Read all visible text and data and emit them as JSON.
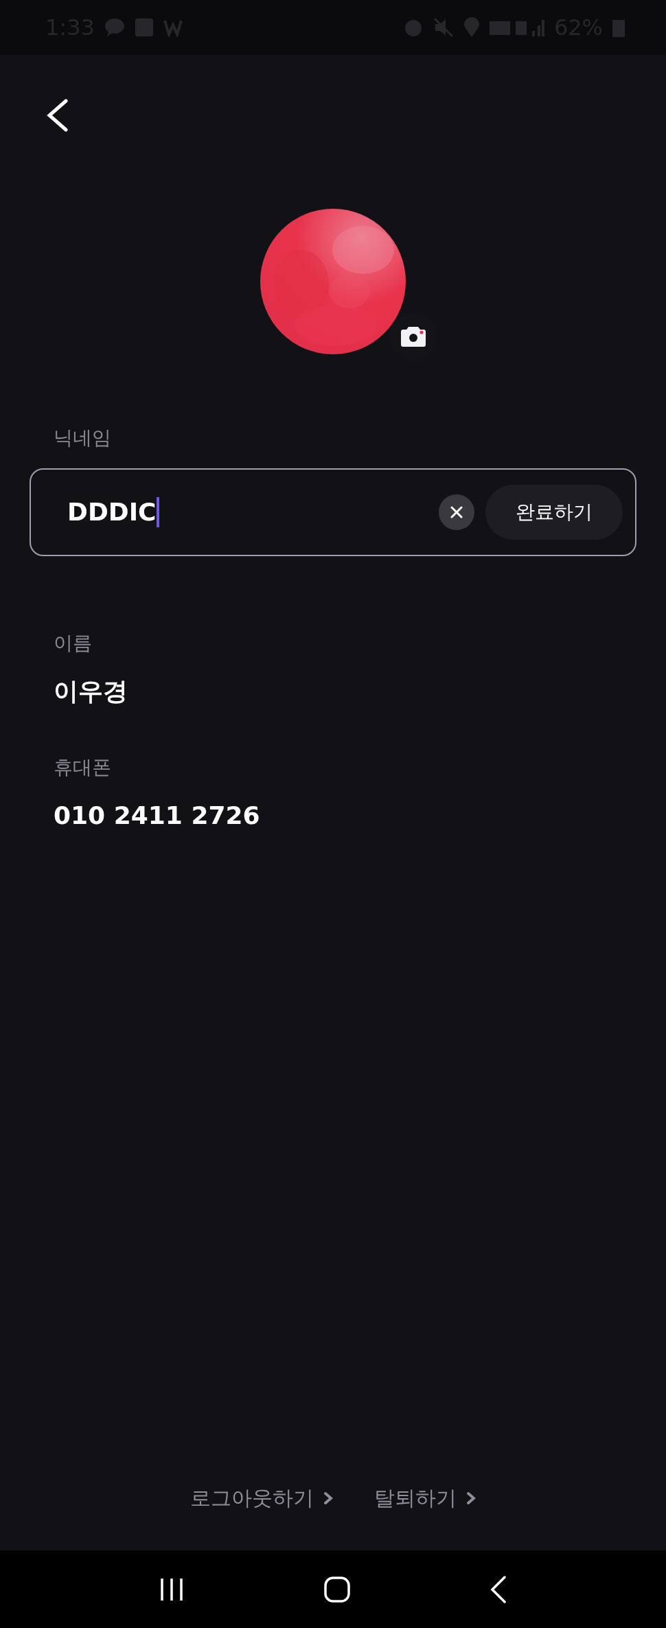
{
  "status_bar": {
    "time": "1:33",
    "battery": "62%"
  },
  "nickname": {
    "label": "닉네임",
    "value": "DDDIC",
    "focused": true,
    "done_button": "완료하기"
  },
  "info": [
    {
      "label": "이름",
      "value": "이우경"
    },
    {
      "label": "휴대폰",
      "value": "010 2411 2726"
    }
  ],
  "links": [
    "로그아웃하기",
    "탈퇴하기"
  ]
}
